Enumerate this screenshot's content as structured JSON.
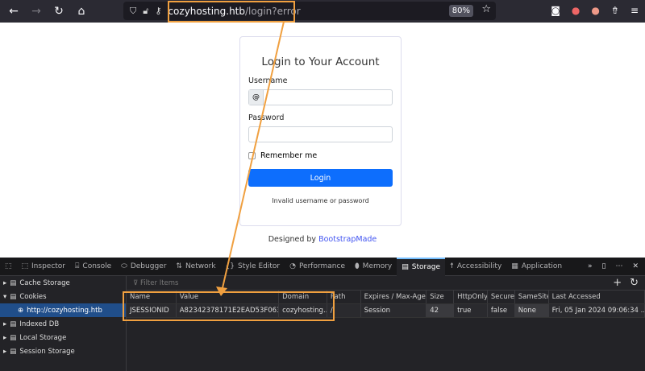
{
  "browser": {
    "host": "cozyhosting.htb",
    "path": "/login?error",
    "zoom": "80%"
  },
  "login": {
    "title": "Login to Your Account",
    "username_label": "Username",
    "username_prefix": "@",
    "password_label": "Password",
    "remember": "Remember me",
    "button": "Login",
    "error": "Invalid username or password",
    "credit_prefix": "Designed by ",
    "credit_link": "BootstrapMade"
  },
  "devtools": {
    "tabs": [
      "Inspector",
      "Console",
      "Debugger",
      "Network",
      "Style Editor",
      "Performance",
      "Memory",
      "Storage",
      "Accessibility",
      "Application"
    ],
    "sidebar": [
      "Cache Storage",
      "Cookies",
      "http://cozyhosting.htb",
      "Indexed DB",
      "Local Storage",
      "Session Storage"
    ],
    "filter_placeholder": "Filter Items",
    "columns": [
      "Name",
      "Value",
      "Domain",
      "Path",
      "Expires / Max-Age",
      "Size",
      "HttpOnly",
      "Secure",
      "SameSite",
      "Last Accessed"
    ],
    "rows": [
      [
        "JSESSIONID",
        "A82342378171E2EAD53F06323...",
        "cozyhosting....",
        "/",
        "Session",
        "42",
        "true",
        "false",
        "None",
        "Fri, 05 Jan 2024 09:06:34 ..."
      ]
    ]
  },
  "colors": {
    "annotation": "#f0a040",
    "accent": "#0d6efd"
  }
}
